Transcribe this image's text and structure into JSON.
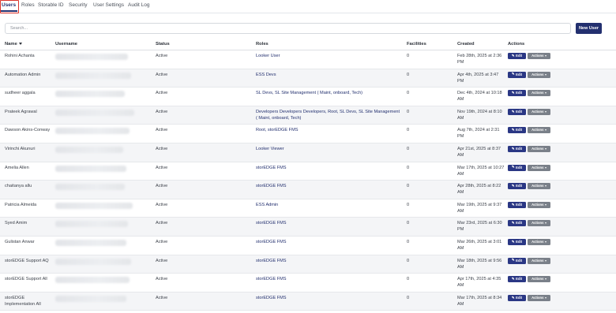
{
  "tabs": [
    {
      "label": "Users",
      "active": true
    },
    {
      "label": "Roles",
      "active": false
    },
    {
      "label": "Storable ID",
      "active": false
    },
    {
      "label": "Security",
      "active": false
    },
    {
      "label": "User Settings",
      "active": false
    },
    {
      "label": "Audit Log",
      "active": false
    }
  ],
  "search": {
    "placeholder": "Search...",
    "value": ""
  },
  "new_user_label": "New User",
  "columns": {
    "name": "Name",
    "username": "Username",
    "status": "Status",
    "roles": "Roles",
    "facilities": "Facilities",
    "created": "Created",
    "actions": "Actions"
  },
  "edit_label": "Edit",
  "actions_label": "Actions",
  "colors": {
    "primary": "#23306f",
    "edit_button": "#2a3784",
    "actions_button": "#7a8089",
    "active_tab_outline": "#d9332b"
  },
  "rows": [
    {
      "name": "Rohini Achanta",
      "status": "Active",
      "roles": "Looker User",
      "facilities": "0",
      "created": "Feb 28th, 2025 at 2:36 PM"
    },
    {
      "name": "Automation Admin",
      "status": "Active",
      "roles": "ESS Devs",
      "facilities": "0",
      "created": "Apr 4th, 2025 at 3:47 PM"
    },
    {
      "name": "sudheer aggala",
      "status": "Active",
      "roles": "SL Devs, SL Site Management ( Maint, onboard, Tech)",
      "facilities": "0",
      "created": "Dec 4th, 2024 at 10:18 AM"
    },
    {
      "name": "Prateek Agrawal",
      "status": "Active",
      "roles": "Developers Developers Developers, Root, SL Devs, SL Site Management ( Maint, onboard, Tech)",
      "facilities": "0",
      "created": "Nov 19th, 2024 at 8:10 AM"
    },
    {
      "name": "Dawson Akins-Conway",
      "status": "Active",
      "roles": "Root, storEDGE FMS",
      "facilities": "0",
      "created": "Aug 7th, 2024 at 2:31 PM"
    },
    {
      "name": "Virinchi Akunuri",
      "status": "Active",
      "roles": "Looker Viewer",
      "facilities": "0",
      "created": "Apr 21st, 2025 at 8:37 AM"
    },
    {
      "name": "Amelia Allen",
      "status": "Active",
      "roles": "storEDGE FMS",
      "facilities": "0",
      "created": "Mar 17th, 2025 at 10:27 AM"
    },
    {
      "name": "chaitanya allu",
      "status": "Active",
      "roles": "storEDGE FMS",
      "facilities": "0",
      "created": "Apr 28th, 2025 at 8:22 AM"
    },
    {
      "name": "Patricia Almeida",
      "status": "Active",
      "roles": "ESS Admin",
      "facilities": "0",
      "created": "Mar 19th, 2025 at 9:37 AM"
    },
    {
      "name": "Syed Amim",
      "status": "Active",
      "roles": "storEDGE FMS",
      "facilities": "0",
      "created": "Mar 23rd, 2025 at 6:30 PM"
    },
    {
      "name": "Gulistan Anwar",
      "status": "Active",
      "roles": "storEDGE FMS",
      "facilities": "0",
      "created": "Mar 26th, 2025 at 3:01 AM"
    },
    {
      "name": "storEDGE Support AQ",
      "status": "Active",
      "roles": "storEDGE FMS",
      "facilities": "0",
      "created": "Mar 18th, 2025 at 9:56 AM"
    },
    {
      "name": "storEDGE Support All",
      "status": "Active",
      "roles": "storEDGE FMS",
      "facilities": "0",
      "created": "Apr 17th, 2025 at 4:35 AM"
    },
    {
      "name": "storEDGE Implementation All",
      "status": "Active",
      "roles": "storEDGE FMS",
      "facilities": "0",
      "created": "Mar 17th, 2025 at 8:34 AM"
    }
  ]
}
